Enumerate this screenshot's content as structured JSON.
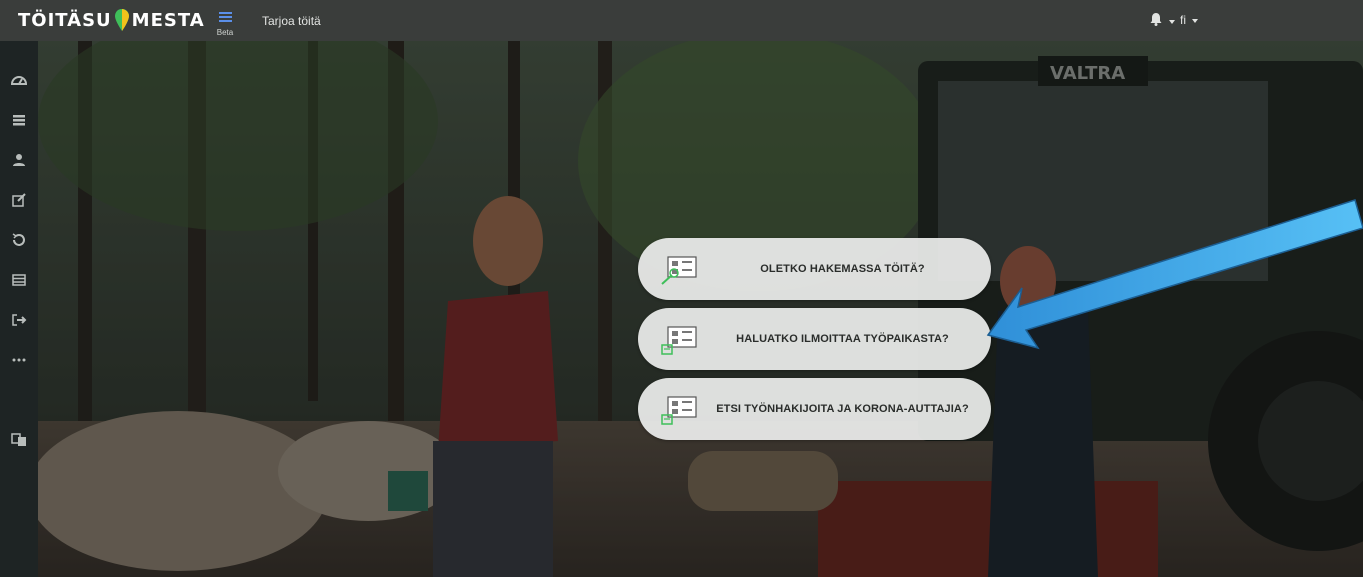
{
  "header": {
    "logo_left": "TÖITÄSU",
    "logo_right": "MESTA",
    "beta": "Beta",
    "nav_link": "Tarjoa töitä",
    "language": "fi"
  },
  "sidebar": {
    "items": [
      "dashboard-icon",
      "list-icon",
      "user-icon",
      "edit-icon",
      "history-icon",
      "table-icon",
      "logout-icon",
      "more-icon",
      "translate-icon"
    ]
  },
  "cards": [
    {
      "label": "OLETKO HAKEMASSA TÖITÄ?"
    },
    {
      "label": "HALUATKO ILMOITTAA TYÖPAIKASTA?"
    },
    {
      "label": "ETSI TYÖNHAKIJOITA JA KORONA-AUTTAJIA?"
    }
  ],
  "colors": {
    "topbar": "#3a3d3b",
    "sidebar": "#1e2424",
    "menu_icon": "#5b8fe8",
    "card_bg": "#ecedec",
    "card_icon_green": "#3fbf5a",
    "arrow": "#39a6ec"
  }
}
